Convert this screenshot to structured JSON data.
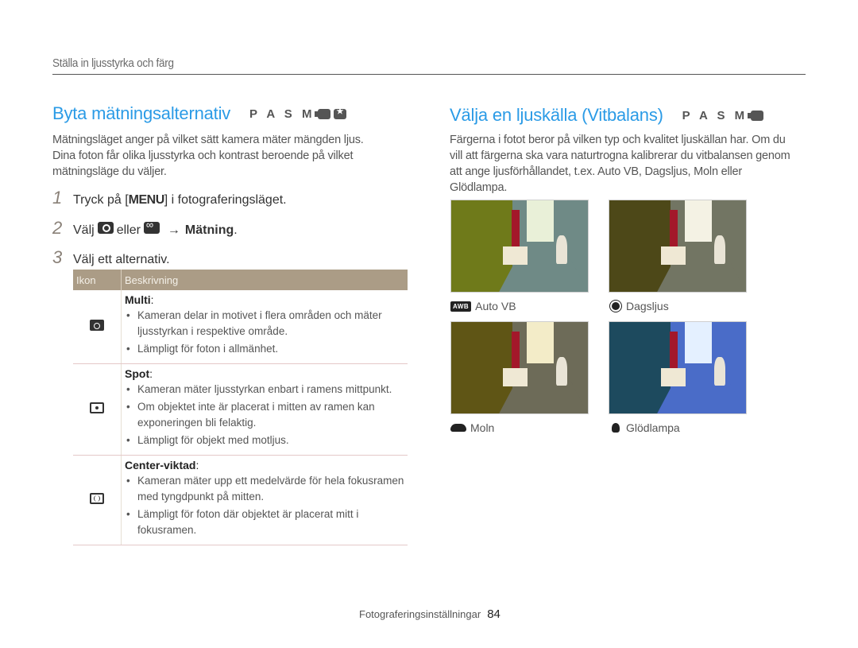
{
  "section_header": "Ställa in ljusstyrka och färg",
  "left": {
    "title": "Byta mätningsalternativ",
    "modes": "P A S M",
    "mode_icons": [
      "movie-mode-icon",
      "smart-mode-icon"
    ],
    "intro": "Mätningsläget anger på vilket sätt kamera mäter mängden ljus. Dina foton får olika ljusstyrka och kontrast beroende på vilket mätningsläge du väljer.",
    "steps": [
      {
        "num": "1",
        "pre": "Tryck på [",
        "key": "MENU",
        "post": "] i fotograferingsläget."
      },
      {
        "num": "2",
        "pre": "Välj",
        "mid": "eller",
        "arrow": "→",
        "bold": "Mätning",
        "post": "."
      },
      {
        "num": "3",
        "text": "Välj ett alternativ."
      }
    ],
    "table": {
      "headers": [
        "Ikon",
        "Beskrivning"
      ],
      "rows": [
        {
          "icon": "multi-metering-icon",
          "name": "Multi",
          "bullets": [
            "Kameran delar in motivet i flera områden och mäter ljusstyrkan i respektive område.",
            "Lämpligt för foton i allmänhet."
          ]
        },
        {
          "icon": "spot-metering-icon",
          "name": "Spot",
          "bullets": [
            "Kameran mäter ljusstyrkan enbart i ramens mittpunkt.",
            "Om objektet inte är placerat i mitten av ramen kan exponeringen bli felaktig.",
            "Lämpligt för objekt med motljus."
          ]
        },
        {
          "icon": "center-weighted-metering-icon",
          "name": "Center-viktad",
          "bullets": [
            "Kameran mäter upp ett medelvärde för hela fokusramen med tyngdpunkt på mitten.",
            "Lämpligt för foton där objektet är placerat mitt i fokusramen."
          ]
        }
      ]
    }
  },
  "right": {
    "title": "Välja en ljuskälla (Vitbalans)",
    "modes": "P A S M",
    "mode_icons": [
      "movie-mode-icon"
    ],
    "intro": "Färgerna i fotot beror på vilken typ och kvalitet ljuskällan har. Om du vill att färgerna ska vara naturtrogna kalibrerar du vitbalansen genom att ange ljusförhållandet, t.ex. Auto VB, Dagsljus, Moln eller Glödlampa.",
    "samples": [
      {
        "label": "Auto VB",
        "icon": "awb-icon",
        "icon_text": "AWB",
        "tint": {
          "shop": "#6f7a1a",
          "street": "#6f8a86",
          "sky": "#e9f0d8"
        }
      },
      {
        "label": "Dagsljus",
        "icon": "daylight-icon",
        "tint": {
          "shop": "#4d4818",
          "street": "#727563",
          "sky": "#f4f2e4"
        }
      },
      {
        "label": "Moln",
        "icon": "cloudy-icon",
        "tint": {
          "shop": "#5f5515",
          "street": "#6d6b58",
          "sky": "#f3ecc8"
        }
      },
      {
        "label": "Glödlampa",
        "icon": "tungsten-icon",
        "tint": {
          "shop": "#1d4a5e",
          "street": "#4a6cc8",
          "sky": "#e4f0ff"
        }
      }
    ]
  },
  "footer": {
    "chapter": "Fotograferingsinställningar",
    "page": "84"
  },
  "colors": {
    "accent": "#2b9be6",
    "table_header": "#ab9c86"
  }
}
